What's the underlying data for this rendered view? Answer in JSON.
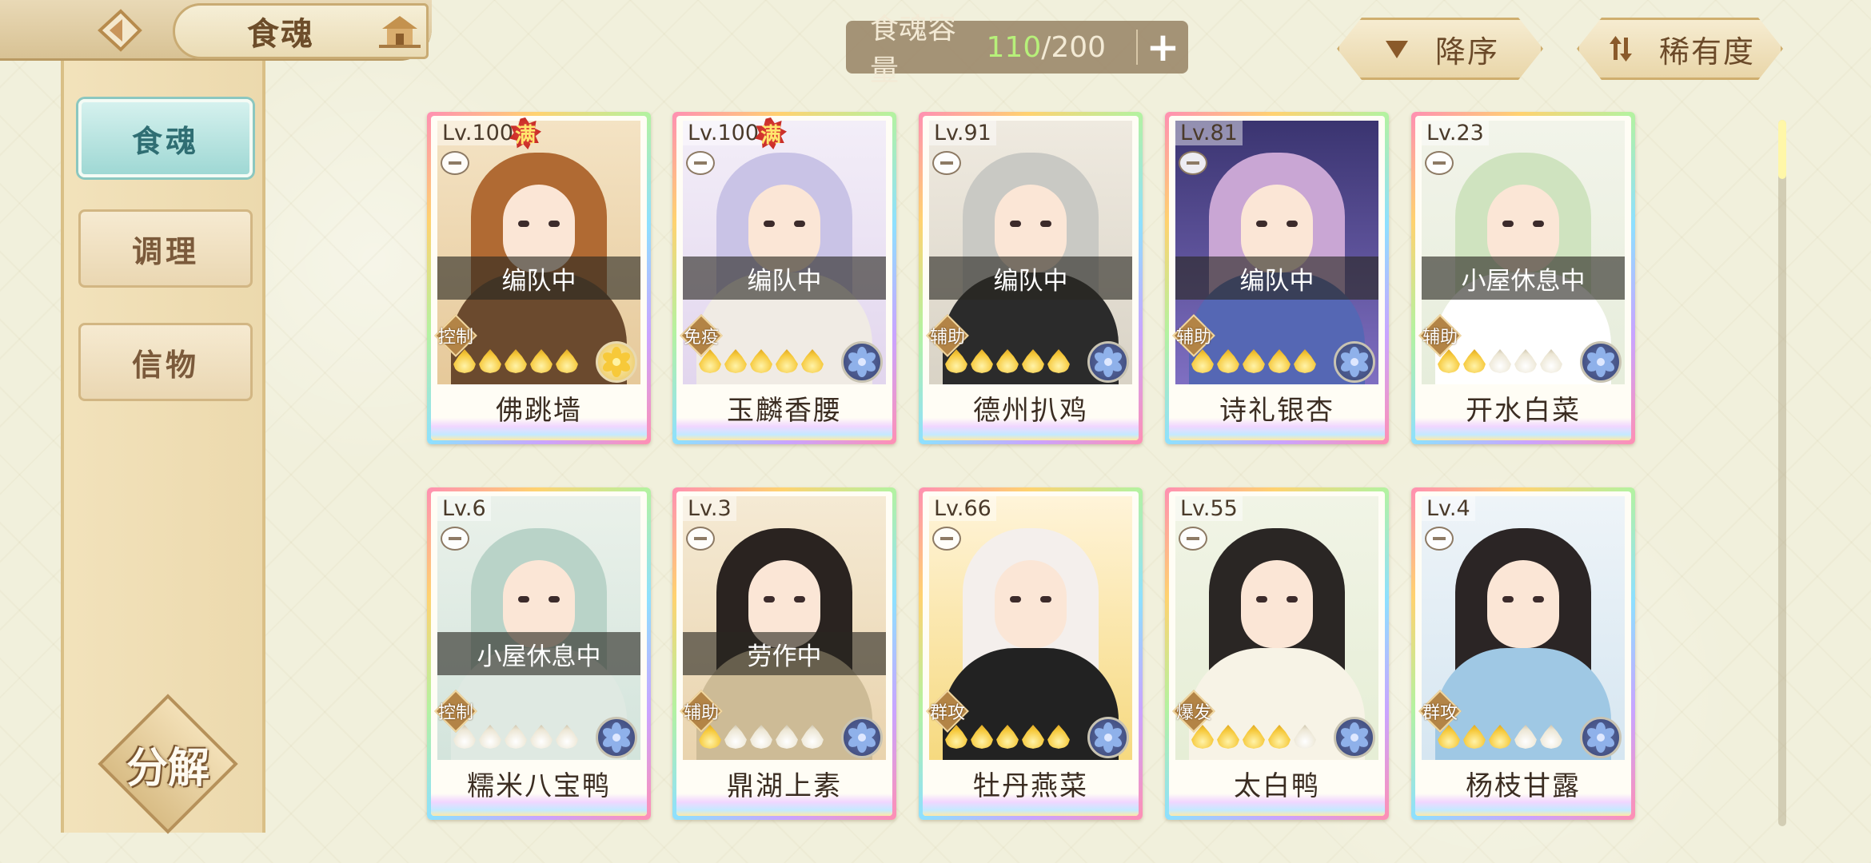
{
  "header": {
    "title": "食魂",
    "capacity_label": "食魂容量",
    "capacity_current": "110",
    "capacity_max": "/200",
    "add_label": "+",
    "sort_order_label": "降序",
    "sort_key_label": "稀有度"
  },
  "sidebar": {
    "items": [
      {
        "label": "食魂",
        "active": true
      },
      {
        "label": "调理",
        "active": false
      },
      {
        "label": "信物",
        "active": false
      }
    ],
    "decompose_label": "分解"
  },
  "cards": [
    {
      "level": "Lv.100",
      "full": "满",
      "status": "编队中",
      "role": "控制",
      "stars": 5,
      "element": "gold-flower",
      "name": "佛跳墙",
      "theme": "brown"
    },
    {
      "level": "Lv.100",
      "full": "满",
      "status": "编队中",
      "role": "免疫",
      "stars": 5,
      "element": "blue-flower",
      "name": "玉麟香腰",
      "theme": "lavender"
    },
    {
      "level": "Lv.91",
      "full": "",
      "status": "编队中",
      "role": "辅助",
      "stars": 5,
      "element": "blue-flower",
      "name": "德州扒鸡",
      "theme": "grey"
    },
    {
      "level": "Lv.81",
      "full": "",
      "status": "编队中",
      "role": "辅助",
      "stars": 5,
      "element": "blue-flower",
      "name": "诗礼银杏",
      "theme": "violet"
    },
    {
      "level": "Lv.23",
      "full": "",
      "status": "小屋休息中",
      "role": "辅助",
      "stars": 2,
      "element": "blue-flower",
      "name": "开水白菜",
      "theme": "green"
    },
    {
      "level": "Lv.6",
      "full": "",
      "status": "小屋休息中",
      "role": "控制",
      "stars": 0,
      "element": "blue-flower",
      "name": "糯米八宝鸭",
      "theme": "mint"
    },
    {
      "level": "Lv.3",
      "full": "",
      "status": "劳作中",
      "role": "辅助",
      "stars": 1,
      "element": "blue-flower",
      "name": "鼎湖上素",
      "theme": "dark"
    },
    {
      "level": "Lv.66",
      "full": "",
      "status": "",
      "role": "群攻",
      "stars": 5,
      "element": "blue-flower",
      "name": "牡丹燕菜",
      "theme": "white"
    },
    {
      "level": "Lv.55",
      "full": "",
      "status": "",
      "role": "爆发",
      "stars": 4,
      "element": "blue-flower",
      "name": "太白鸭",
      "theme": "black"
    },
    {
      "level": "Lv.4",
      "full": "",
      "status": "",
      "role": "群攻",
      "stars": 3,
      "element": "blue-flower",
      "name": "杨枝甘露",
      "theme": "sky"
    }
  ],
  "colors": {
    "capacity_highlight": "#b7f07a",
    "active_tab": "#9fd8d4",
    "gold": "#f6c93c"
  }
}
